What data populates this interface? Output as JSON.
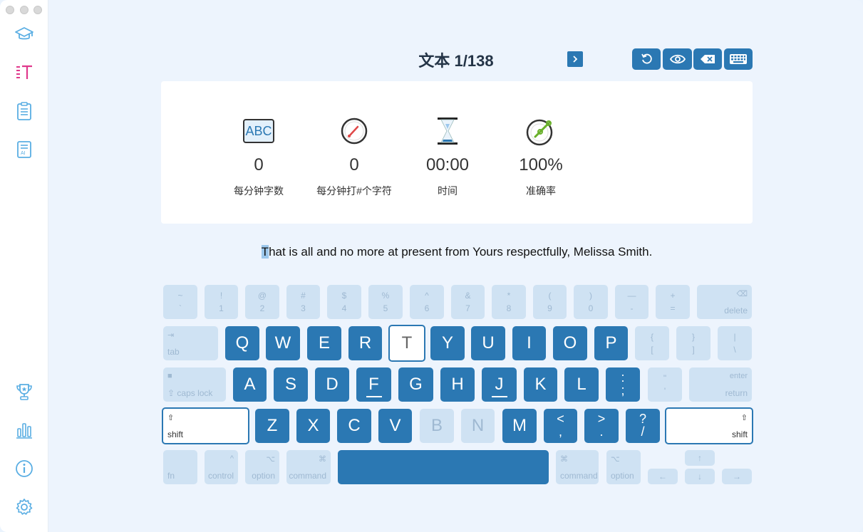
{
  "header": {
    "title": "文本 1/138"
  },
  "toolbar": {
    "next": "next-arrow",
    "restart": "restart-icon",
    "preview": "eye-icon",
    "delete": "delete-icon",
    "keyboard": "keyboard-icon"
  },
  "sidebar": {
    "items": [
      {
        "icon": "graduation-cap-icon"
      },
      {
        "icon": "text-lines-icon"
      },
      {
        "icon": "clipboard-icon"
      },
      {
        "icon": "ai-document-icon"
      },
      {
        "icon": "trophy-icon"
      },
      {
        "icon": "bar-chart-icon"
      },
      {
        "icon": "info-icon"
      },
      {
        "icon": "settings-icon"
      }
    ]
  },
  "stats": {
    "wpm": {
      "value": "0",
      "label": "每分钟字数",
      "icon_text": "ABC"
    },
    "cpm": {
      "value": "0",
      "label": "每分钟打#个字符"
    },
    "time": {
      "value": "00:00",
      "label": "时间"
    },
    "accuracy": {
      "value": "100%",
      "label": "准确率"
    }
  },
  "prompt": {
    "current_char": "T",
    "rest": "hat is all and no more at present from Yours respectfully, Melissa Smith."
  },
  "keyboard": {
    "row1": [
      {
        "top": "~",
        "bot": "`"
      },
      {
        "top": "!",
        "bot": "1"
      },
      {
        "top": "@",
        "bot": "2"
      },
      {
        "top": "#",
        "bot": "3"
      },
      {
        "top": "$",
        "bot": "4"
      },
      {
        "top": "%",
        "bot": "5"
      },
      {
        "top": "^",
        "bot": "6"
      },
      {
        "top": "&",
        "bot": "7"
      },
      {
        "top": "*",
        "bot": "8"
      },
      {
        "top": "(",
        "bot": "9"
      },
      {
        "top": ")",
        "bot": "0"
      },
      {
        "top": "—",
        "bot": "-"
      },
      {
        "top": "+",
        "bot": "="
      }
    ],
    "delete": {
      "icon": "⌫",
      "label": "delete"
    },
    "tab": {
      "icon": "⇥",
      "label": "tab"
    },
    "row2": [
      "Q",
      "W",
      "E",
      "R",
      "T",
      "Y",
      "U",
      "I",
      "O",
      "P"
    ],
    "row2_sym": [
      {
        "top": "{",
        "bot": "["
      },
      {
        "top": "}",
        "bot": "]"
      },
      {
        "top": "|",
        "bot": "\\"
      }
    ],
    "caps": {
      "icon": "■",
      "label": "⇪ caps lock"
    },
    "row3": [
      "A",
      "S",
      "D",
      "F",
      "G",
      "H",
      "J",
      "K",
      "L"
    ],
    "row3_sym": [
      {
        "top": ":",
        "bot": ";"
      },
      {
        "top": "\"",
        "bot": "'"
      }
    ],
    "return": {
      "top": "enter",
      "label": "return"
    },
    "shift_left": {
      "icon": "⇧",
      "label": "shift"
    },
    "row4": [
      "Z",
      "X",
      "C",
      "V",
      "B",
      "N",
      "M"
    ],
    "row4_sym": [
      {
        "top": "<",
        "bot": ","
      },
      {
        "top": ">",
        "bot": "."
      },
      {
        "top": "?",
        "bot": "/"
      }
    ],
    "shift_right": {
      "icon": "⇧",
      "label": "shift"
    },
    "row5": {
      "fn": "fn",
      "control": {
        "icon": "^",
        "label": "control"
      },
      "option_left": {
        "icon": "⌥",
        "label": "option"
      },
      "command_left": {
        "icon": "⌘",
        "label": "command"
      },
      "command_right": {
        "icon": "⌘",
        "label": "command"
      },
      "option_right": {
        "icon": "⌥",
        "label": "option"
      },
      "arrow_left": "←",
      "arrow_up": "↑",
      "arrow_down": "↓",
      "arrow_right": "→"
    }
  },
  "colors": {
    "accent": "#2b78b3",
    "disabled_key": "#cfe2f3",
    "sidebar_active": "#e0398c",
    "sidebar_icon": "#5aaee3"
  }
}
